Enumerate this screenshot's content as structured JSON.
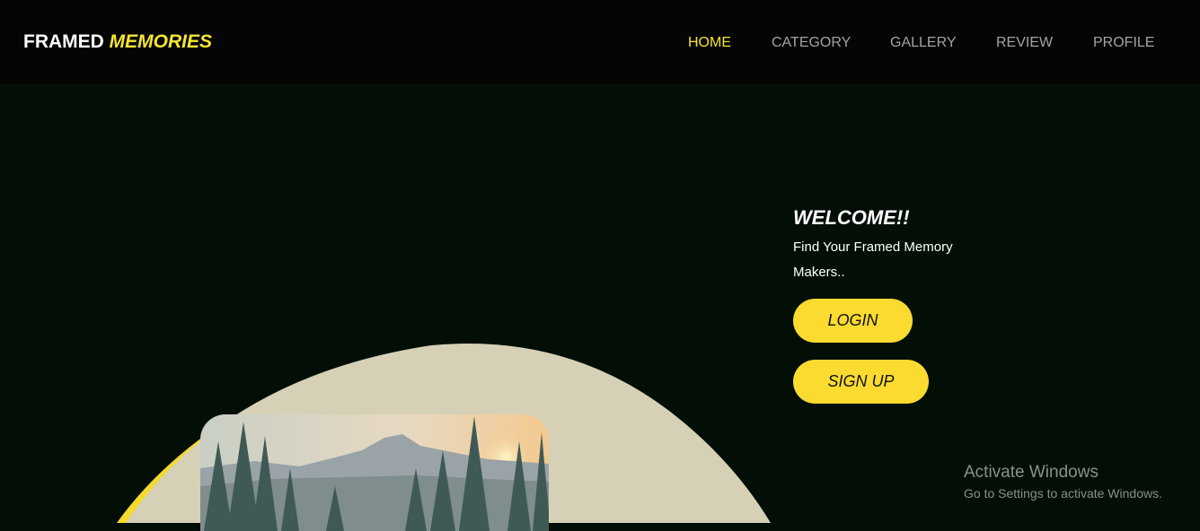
{
  "logo": {
    "part1": "FRAMED",
    "part2": "MEMORIES"
  },
  "nav": {
    "items": [
      {
        "label": "HOME",
        "active": true
      },
      {
        "label": "CATEGORY",
        "active": false
      },
      {
        "label": "GALLERY",
        "active": false
      },
      {
        "label": "REVIEW",
        "active": false
      },
      {
        "label": "PROFILE",
        "active": false
      }
    ]
  },
  "hero": {
    "title": "WELCOME!!",
    "subtitle": "Find Your Framed Memory Makers..",
    "login_label": "LOGIN",
    "signup_label": "SIGN UP"
  },
  "watermark": {
    "title": "Activate Windows",
    "subtitle": "Go to Settings to activate Windows."
  },
  "colors": {
    "background": "#030f06",
    "navbar": "#050505",
    "accent": "#f4e531",
    "button": "#fbdb30",
    "blob": "#d6d1b6"
  },
  "icons": {
    "photo": "landscape-photo"
  }
}
